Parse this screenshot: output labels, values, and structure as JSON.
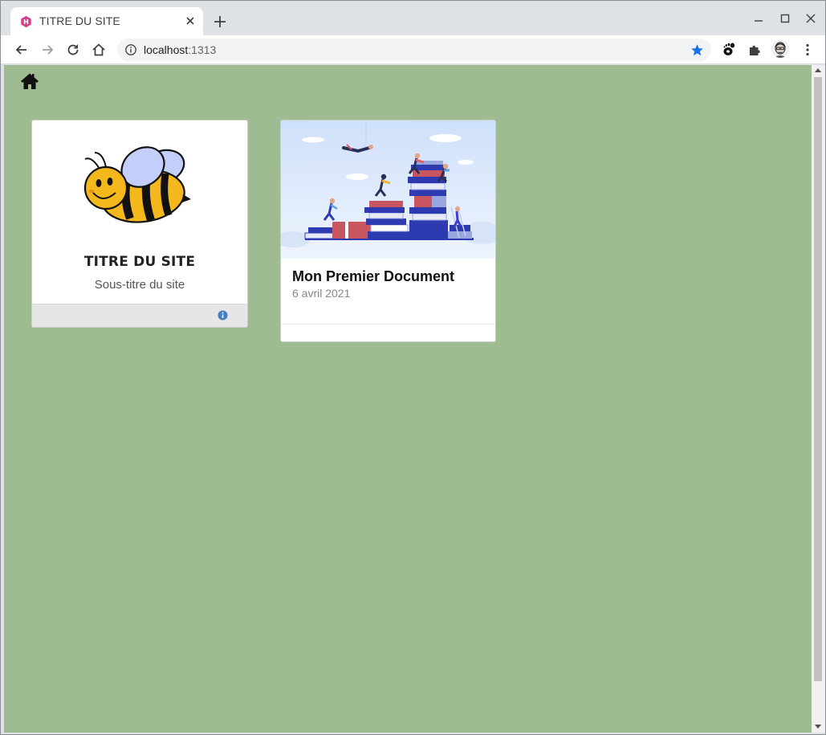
{
  "browser": {
    "tab_title": "TITRE DU SITE",
    "url_host": "localhost",
    "url_port": ":1313"
  },
  "site": {
    "title": "TITRE DU SITE",
    "subtitle": "Sous-titre du site"
  },
  "document": {
    "title": "Mon Premier Document",
    "date": "6 avril 2021"
  },
  "colors": {
    "page_background": "#9ebb91",
    "card_background": "#ffffff",
    "footer_background": "#e6e6e6",
    "info_icon": "#4a7cc0",
    "bookmark_star": "#1a73e8",
    "favicon": "#d53f8c"
  },
  "icons": [
    "house-icon",
    "info-circle-icon",
    "bee-illustration",
    "books-illustration",
    "star-icon",
    "puzzle-icon",
    "back-arrow-icon",
    "forward-arrow-icon",
    "reload-icon",
    "close-icon",
    "plus-icon",
    "kebab-menu-icon"
  ]
}
